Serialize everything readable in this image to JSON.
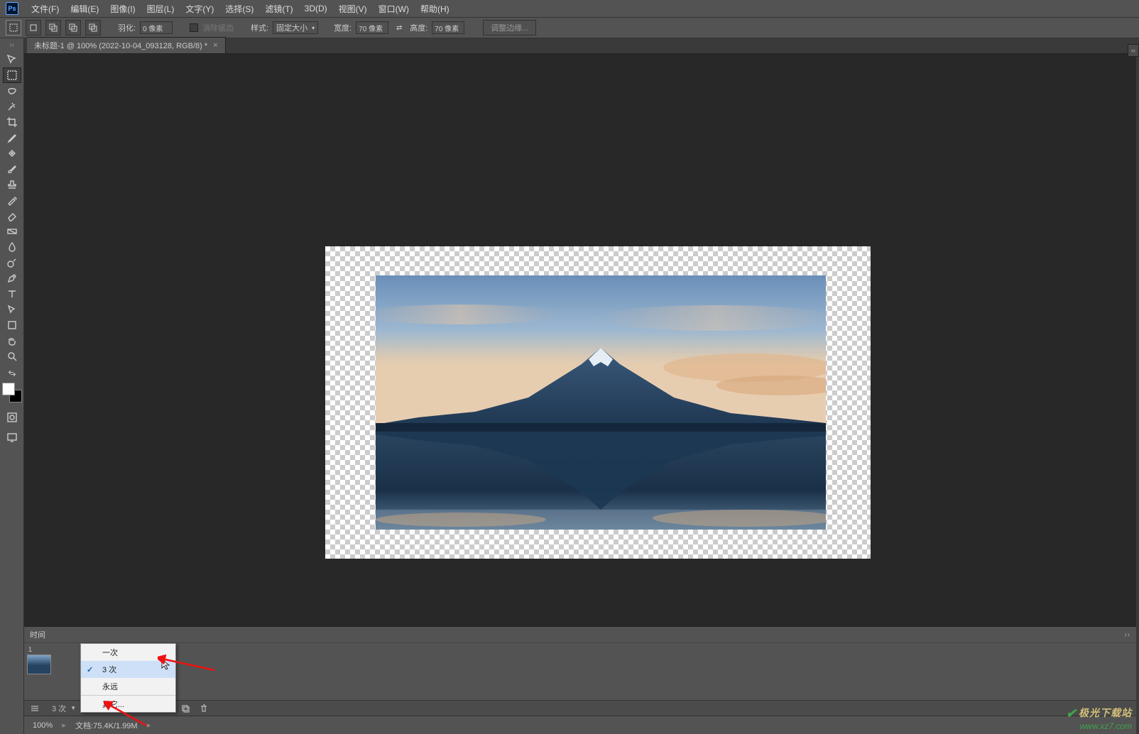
{
  "menubar": {
    "items": [
      "文件(F)",
      "编辑(E)",
      "图像(I)",
      "图层(L)",
      "文字(Y)",
      "选择(S)",
      "滤镜(T)",
      "3D(D)",
      "视图(V)",
      "窗口(W)",
      "帮助(H)"
    ]
  },
  "optionsbar": {
    "feather_label": "羽化:",
    "feather_value": "0 像素",
    "anti_alias_label": "消除锯齿",
    "style_label": "样式:",
    "style_value": "固定大小",
    "width_label": "宽度:",
    "width_value": "70 像素",
    "height_label": "高度:",
    "height_value": "70 像素",
    "refine_btn": "调整边缘..."
  },
  "document": {
    "tab_title": "未标题-1 @ 100% (2022-10-04_093128, RGB/8) *"
  },
  "timeline": {
    "panel_label": "时间",
    "frame_number": "1",
    "loop_options": [
      "一次",
      "3 次",
      "永远",
      "其它..."
    ],
    "loop_selected_index": 1,
    "loop_selected_label": "3 次"
  },
  "statusbar": {
    "zoom": "100%",
    "info_label": "文档:",
    "info_value": "75.4K/1.99M"
  },
  "watermark": {
    "line1": "极光下载站",
    "line2": "www.xz7.com"
  }
}
